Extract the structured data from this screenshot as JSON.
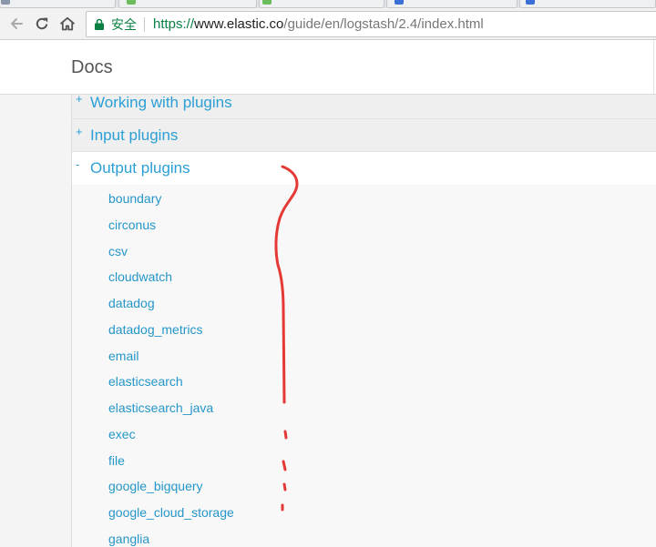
{
  "browser": {
    "tabs": [
      {
        "favicon": "page-icon",
        "color": "#8a96ab"
      },
      {
        "favicon": "page-icon",
        "color": "#6bbd5b"
      },
      {
        "favicon": "page-icon",
        "color": "#6bbd5b"
      },
      {
        "favicon": "page-icon",
        "color": "#3d6fd8"
      },
      {
        "favicon": "page-icon",
        "color": "#3d6fd8"
      }
    ],
    "nav_icons": {
      "back": "back-arrow-icon",
      "reload": "reload-icon",
      "home": "home-icon"
    },
    "security_label": "安全",
    "url": {
      "scheme": "https://",
      "host": "www.elastic.co",
      "path": "/guide/en/logstash/2.4/index.html"
    }
  },
  "header": {
    "title": "Docs"
  },
  "nav": {
    "sections": [
      {
        "toggle": "+",
        "label": "Working with plugins"
      },
      {
        "toggle": "+",
        "label": "Input plugins"
      },
      {
        "toggle": "-",
        "label": "Output plugins"
      }
    ],
    "output_items": [
      "boundary",
      "circonus",
      "csv",
      "cloudwatch",
      "datadog",
      "datadog_metrics",
      "email",
      "elasticsearch",
      "elasticsearch_java",
      "exec",
      "file",
      "google_bigquery",
      "google_cloud_storage",
      "ganglia"
    ]
  },
  "colors": {
    "link": "#2596c9",
    "section_link": "#2b9fd5",
    "secure_green": "#0b8043",
    "annotation_red": "#e53935"
  }
}
